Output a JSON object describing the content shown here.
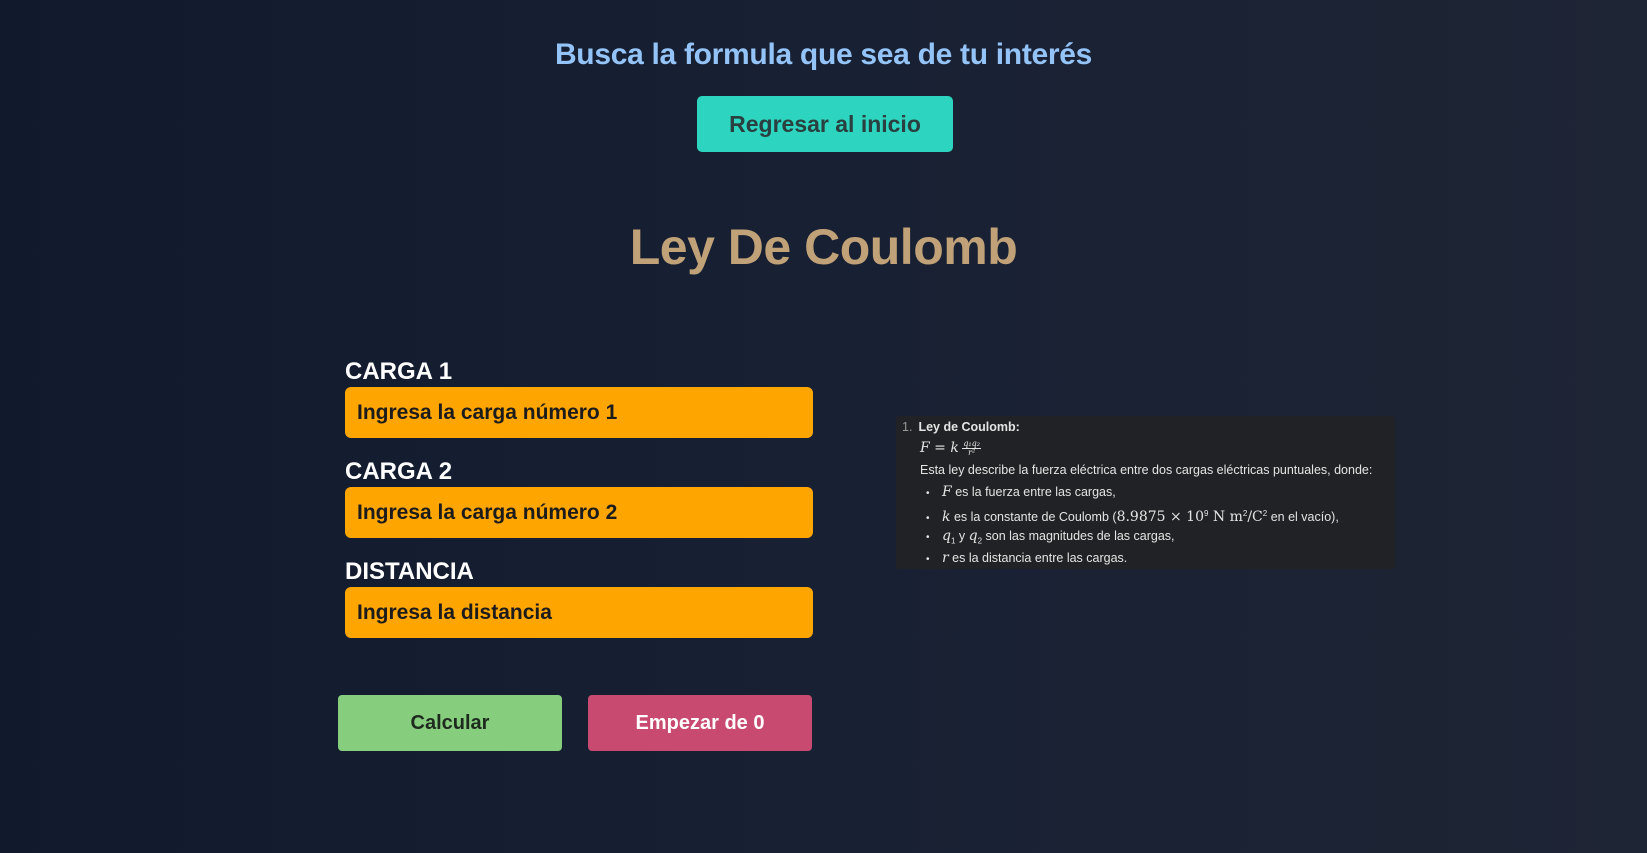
{
  "header": {
    "title": "Busca la formula que sea de tu interés",
    "home_button_label": "Regresar al inicio"
  },
  "page_title": "Ley De Coulomb",
  "form": {
    "fields": [
      {
        "label": "CARGA 1",
        "placeholder": "Ingresa la carga número 1",
        "value": ""
      },
      {
        "label": "CARGA 2",
        "placeholder": "Ingresa la carga número 2",
        "value": ""
      },
      {
        "label": "DISTANCIA",
        "placeholder": "Ingresa la distancia",
        "value": ""
      }
    ],
    "calculate_label": "Calcular",
    "reset_label": "Empezar de 0"
  },
  "formula_card": {
    "list_number": "1.",
    "heading": "Ley de Coulomb:",
    "formula_lhs": "F = k",
    "formula_num": "q₁q₂",
    "formula_den": "r²",
    "description": "Esta ley describe la fuerza eléctrica entre dos cargas eléctricas puntuales, donde:",
    "bullets": [
      {
        "symbol": "F",
        "text": " es la fuerza entre las cargas,"
      },
      {
        "symbol": "k",
        "text": " es la constante de Coulomb (",
        "constant": "8.9875 × 10",
        "exp": "9",
        "units": " N m",
        "units_exp": "2",
        "units_tail": "/C",
        "units_tail_exp": "2",
        "tail": " en el vacío),"
      },
      {
        "symbol_a": "q",
        "sub_a": "1",
        "mid": " y ",
        "symbol_b": "q",
        "sub_b": "2",
        "text": " son las magnitudes de las cargas,"
      },
      {
        "symbol": "r",
        "text": " es la distancia entre las cargas."
      }
    ]
  },
  "colors": {
    "accent_title": "#94c4f7",
    "home_button": "#2dd4bf",
    "page_title": "#c1a278",
    "input_bg": "#ffa500",
    "calculate_button": "#86ce7e",
    "reset_button": "#c94a70"
  }
}
